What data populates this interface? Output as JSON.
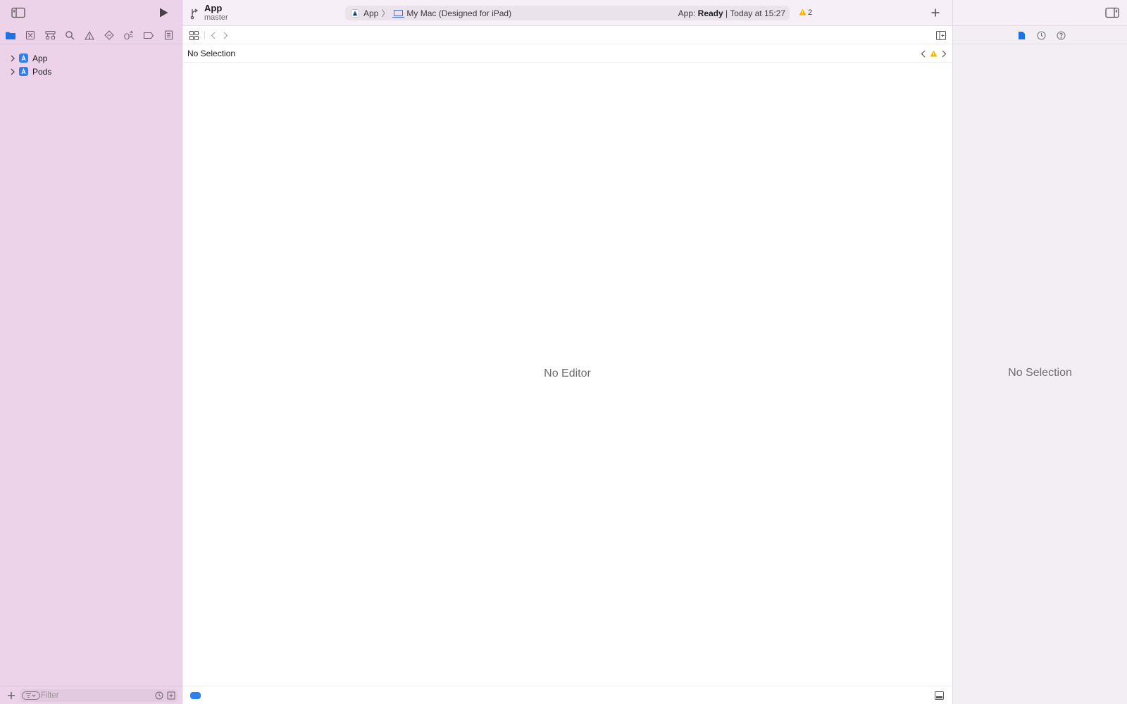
{
  "toolbar": {
    "project_name": "App",
    "branch": "master",
    "scheme": "App",
    "destination": "My Mac (Designed for iPad)",
    "status_prefix": "App: ",
    "status_state": "Ready",
    "status_suffix": " | Today at 15:27",
    "warning_count": "2"
  },
  "navigator": {
    "items": [
      {
        "label": "App",
        "icon": "app-project-icon"
      },
      {
        "label": "Pods",
        "icon": "app-project-icon"
      }
    ],
    "filter_placeholder": "Filter"
  },
  "editor": {
    "jump_bar_title": "No Selection",
    "empty_message": "No Editor"
  },
  "inspector": {
    "empty_message": "No Selection"
  },
  "colors": {
    "accent": "#1a73e8",
    "navigator_bg": "#ecd3ea",
    "warning": "#f5b400"
  }
}
